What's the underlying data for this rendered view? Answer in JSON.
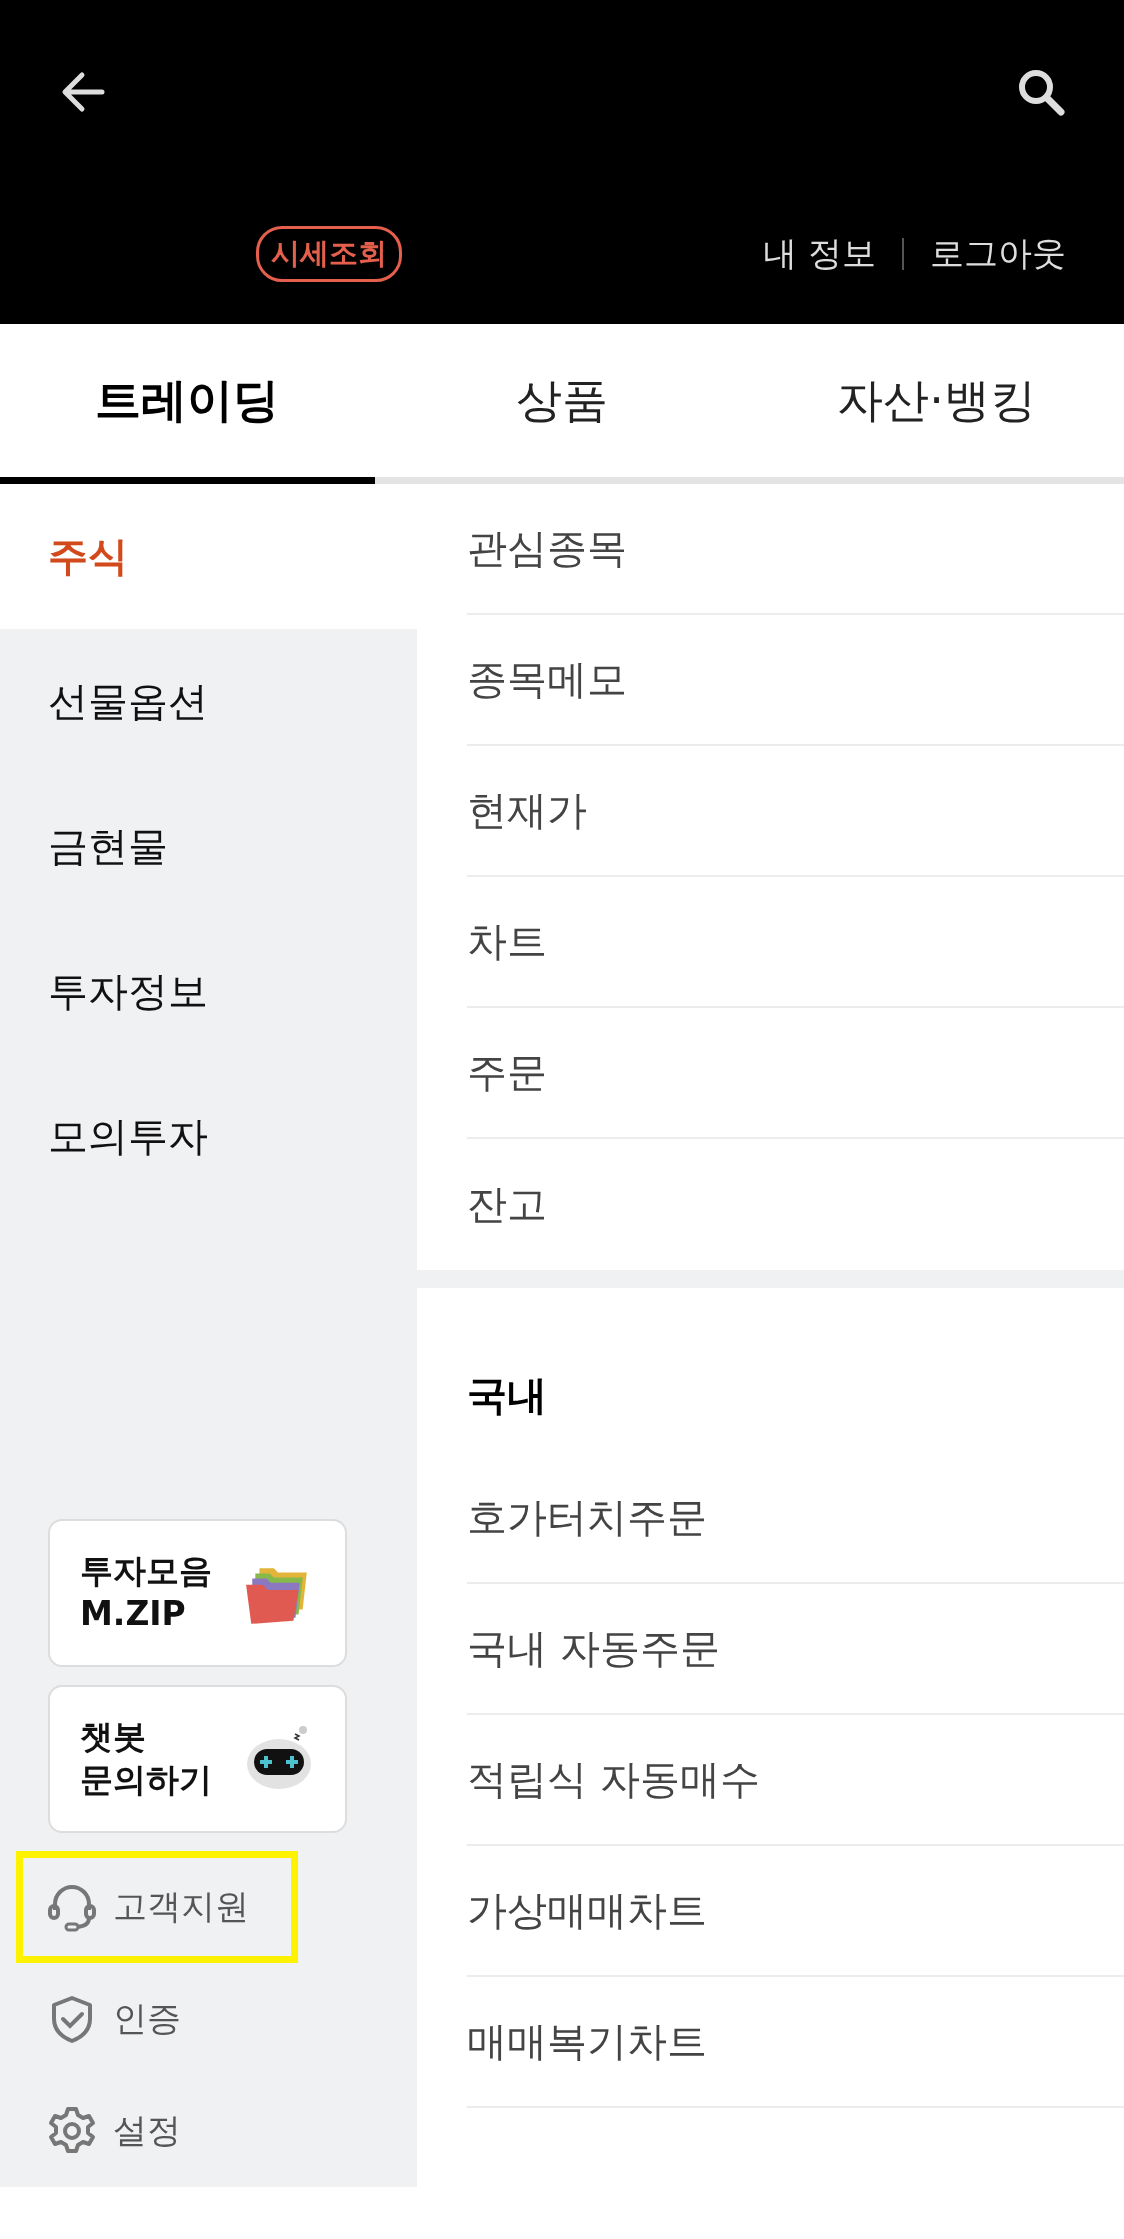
{
  "header": {
    "badge": "시세조회",
    "links": [
      "내 정보",
      "로그아웃"
    ]
  },
  "tabs": [
    {
      "label": "트레이딩",
      "selected": true
    },
    {
      "label": "상품",
      "selected": false
    },
    {
      "label": "자산·뱅킹",
      "selected": false
    }
  ],
  "sidebar": {
    "items": [
      {
        "label": "주식",
        "selected": true
      },
      {
        "label": "선물옵션",
        "selected": false
      },
      {
        "label": "금현물",
        "selected": false
      },
      {
        "label": "투자정보",
        "selected": false
      },
      {
        "label": "모의투자",
        "selected": false
      }
    ],
    "cards": [
      {
        "kind": "folders",
        "lines": [
          "투자모음",
          "M.ZIP"
        ]
      },
      {
        "kind": "robot",
        "lines": [
          "챗봇",
          "문의하기"
        ]
      }
    ],
    "footer": [
      {
        "kind": "headset",
        "label": "고객지원",
        "highlighted": true
      },
      {
        "kind": "shield",
        "label": "인증",
        "highlighted": false
      },
      {
        "kind": "gear",
        "label": "설정",
        "highlighted": false
      }
    ]
  },
  "menu": {
    "items": [
      "관심종목",
      "종목메모",
      "현재가",
      "차트",
      "주문",
      "잔고"
    ],
    "section_title": "국내",
    "section_items": [
      "호가터치주문",
      "국내 자동주문",
      "적립식 자동매수",
      "가상매매차트",
      "매매복기차트"
    ]
  }
}
